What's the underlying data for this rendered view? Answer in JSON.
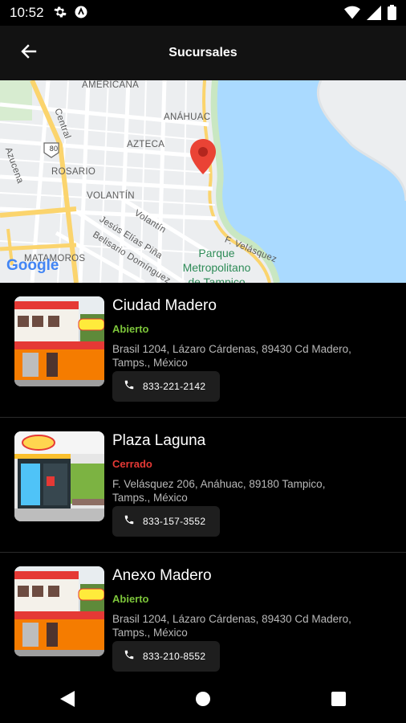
{
  "status_bar": {
    "time": "10:52"
  },
  "app_bar": {
    "title": "Sucursales"
  },
  "map": {
    "labels": {
      "americana": "AMERICANA",
      "anahuac": "ANÁHUAC",
      "azteca": "AZTECA",
      "rosario": "ROSARIO",
      "volantin": "VOLANTÍN",
      "volantin_street": "Volantín",
      "jesus": "Jesús Elías Piña",
      "belisario": "Belisario Domínguez",
      "central": "Central",
      "azucena": "Azucena",
      "matamoros": "MATAMOROS",
      "velasquez": "F. Velásquez",
      "route": "80",
      "park_line1": "Parque",
      "park_line2": "Metropolitano",
      "park_line3": "de Tampico",
      "google": "Google"
    }
  },
  "branches": [
    {
      "name": "Ciudad Madero",
      "status": "Abierto",
      "status_color": "#7cc53a",
      "address_line1": "Brasil 1204, Lázaro Cárdenas, 89430 Cd Madero,",
      "address_line2": "Tamps., México",
      "phone": "833-221-2142"
    },
    {
      "name": "Plaza Laguna",
      "status": "Cerrado",
      "status_color": "#e53935",
      "address_line1": "F. Velásquez 206, Anáhuac, 89180 Tampico,",
      "address_line2": "Tamps., México",
      "phone": "833-157-3552"
    },
    {
      "name": "Anexo Madero",
      "status": "Abierto",
      "status_color": "#7cc53a",
      "address_line1": "Brasil 1204, Lázaro Cárdenas, 89430 Cd Madero,",
      "address_line2": "Tamps., México",
      "phone": "833-210-8552"
    }
  ],
  "icons": {
    "back": "arrow-left-icon",
    "phone": "phone-icon",
    "settings": "gear-icon",
    "wifi": "wifi-icon",
    "signal": "signal-icon",
    "battery": "battery-icon",
    "map_pin": "map-pin-icon",
    "nav_back": "triangle-back-icon",
    "nav_home": "circle-home-icon",
    "nav_recents": "square-recents-icon"
  },
  "colors": {
    "open": "#7cc53a",
    "closed": "#e53935",
    "app_bar": "#121212",
    "map_water": "#aadaff",
    "map_park": "#c9e7c2",
    "pin": "#ea4335"
  }
}
